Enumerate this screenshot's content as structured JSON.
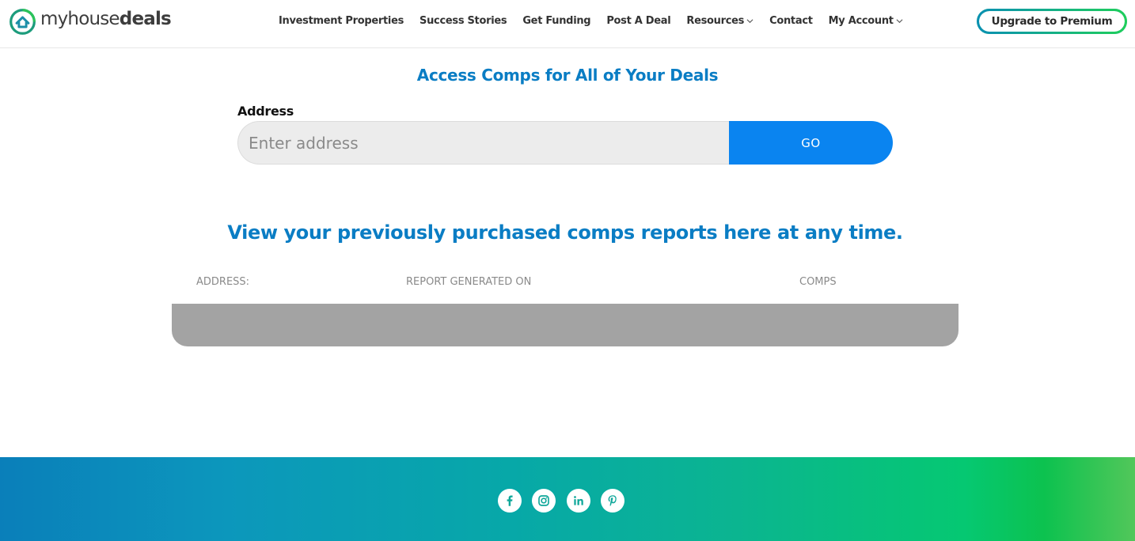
{
  "brand": {
    "logo_light": "myhouse",
    "logo_bold": "deals",
    "logo_icon": "house-circle-icon",
    "colors": {
      "primary_blue": "#0a7dc4",
      "button_blue": "#0a84f0",
      "green": "#1fcf5a"
    }
  },
  "nav": {
    "items": [
      {
        "label": "Investment Properties"
      },
      {
        "label": "Success Stories"
      },
      {
        "label": "Get Funding"
      },
      {
        "label": "Post A Deal"
      },
      {
        "label": "Resources",
        "dropdown": true
      },
      {
        "label": "Contact"
      },
      {
        "label": "My Account",
        "dropdown": true
      }
    ],
    "premium_label": "Upgrade to Premium"
  },
  "comps": {
    "title": "Access Comps for All of Your Deals",
    "address_label": "Address",
    "address_placeholder": "Enter address",
    "address_value": "",
    "go_label": "GO"
  },
  "reports": {
    "title": "View your previously purchased comps reports here at any time.",
    "columns": [
      "ADDRESS:",
      "REPORT GENERATED ON",
      "COMPS"
    ],
    "rows": []
  },
  "footer": {
    "social": [
      "facebook-icon",
      "instagram-icon",
      "linkedin-icon",
      "pinterest-icon"
    ]
  }
}
